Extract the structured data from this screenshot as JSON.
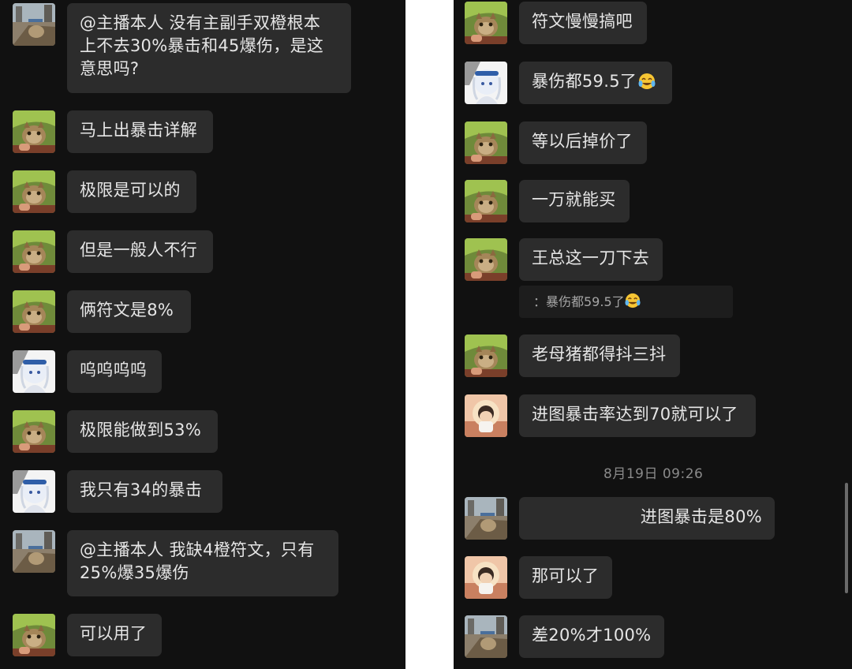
{
  "left_panel": {
    "messages": [
      {
        "avatar": "cat-avatar-street",
        "text": "@主播本人 没有主副手双橙根本\n上不去30%暴击和45爆伤，是这\n意思吗?"
      },
      {
        "avatar": "cat-avatar-green",
        "text": "马上出暴击详解"
      },
      {
        "avatar": "cat-avatar-green",
        "text": "极限是可以的"
      },
      {
        "avatar": "cat-avatar-green",
        "text": "但是一般人不行"
      },
      {
        "avatar": "cat-avatar-green",
        "text": "俩符文是8%"
      },
      {
        "avatar": "anime-girl-avatar",
        "text": "呜呜呜呜"
      },
      {
        "avatar": "cat-avatar-green",
        "text": "极限能做到53%"
      },
      {
        "avatar": "anime-girl-avatar",
        "text": "我只有34的暴击"
      },
      {
        "avatar": "cat-avatar-street",
        "text": "@主播本人 我缺4橙符文，只有\n25%爆35爆伤"
      },
      {
        "avatar": "cat-avatar-green",
        "text": "可以用了"
      }
    ]
  },
  "right_panel": {
    "messages": [
      {
        "avatar": "cat-avatar-green",
        "text": "符文慢慢搞吧"
      },
      {
        "avatar": "anime-girl-avatar",
        "text": "暴伤都59.5了",
        "emoji": "laughing-crying-emoji"
      },
      {
        "avatar": "cat-avatar-green",
        "text": "等以后掉价了"
      },
      {
        "avatar": "cat-avatar-green",
        "text": "一万就能买"
      },
      {
        "avatar": "cat-avatar-green",
        "text": "王总这一刀下去"
      },
      {
        "avatar": "cat-avatar-green",
        "text": "老母猪都得抖三抖"
      },
      {
        "avatar": "boy-sunset-avatar",
        "text": "进图暴击率达到70就可以了"
      },
      {
        "avatar": "cat-avatar-street",
        "text": "进图暴击是80%"
      },
      {
        "avatar": "boy-sunset-avatar",
        "text": "那可以了"
      },
      {
        "avatar": "cat-avatar-street",
        "text": "差20%才100%"
      }
    ],
    "quote": {
      "text": "：暴伤都59.5了",
      "emoji": "laughing-crying-emoji"
    },
    "timestamp": "8月19日 09:26"
  }
}
